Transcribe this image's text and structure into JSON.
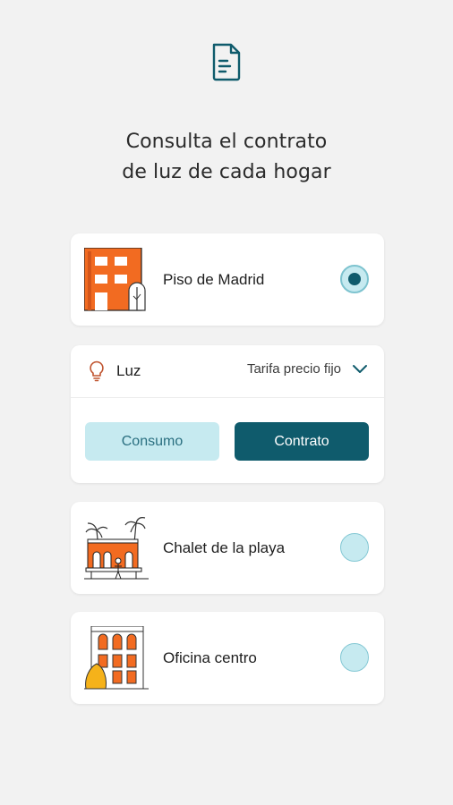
{
  "headline": {
    "line1": "Consulta el contrato",
    "line2": "de luz de cada hogar"
  },
  "homes": [
    {
      "name": "Piso de Madrid",
      "selected": true,
      "icon": "apartment-building-icon"
    },
    {
      "name": "Chalet de la playa",
      "selected": false,
      "icon": "beach-house-icon"
    },
    {
      "name": "Oficina centro",
      "selected": false,
      "icon": "office-building-icon"
    }
  ],
  "supply": {
    "icon": "lightbulb-icon",
    "label": "Luz",
    "tariff": "Tarifa precio fijo",
    "buttons": {
      "consumo": "Consumo",
      "contrato": "Contrato"
    }
  },
  "colors": {
    "background": "#f2f2f2",
    "primary": "#0f5b6c",
    "light_accent": "#c6eaf0",
    "orange": "#f26b21",
    "bulb": "#c0542f"
  }
}
